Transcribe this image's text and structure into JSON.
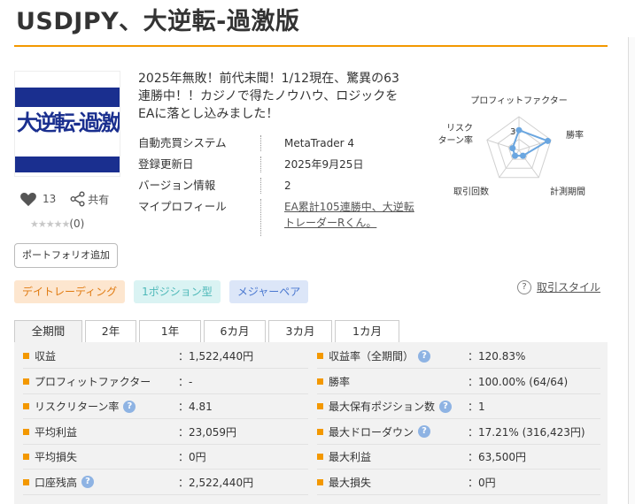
{
  "title": "USDJPY、大逆転-過激版",
  "logo_text": "大逆転-過激版",
  "likes": "13",
  "share_label": "共有",
  "stars": "★★★★★",
  "rating_count": "(0)",
  "portfolio_button": "ポートフォリオ追加",
  "description": "2025年無敗！前代未聞！1/12現在、驚異の63連勝中！！カジノで得たノウハウ、ロジックを EAに落とし込みました！",
  "info": [
    {
      "label": "自動売買システム",
      "value": "MetaTrader 4"
    },
    {
      "label": "登録更新日",
      "value": "2025年9月25日"
    },
    {
      "label": "バージョン情報",
      "value": "2"
    },
    {
      "label": "マイプロフィール",
      "value": "EA累計105連勝中、大逆転トレーダーRくん。"
    }
  ],
  "radar": {
    "labels": [
      "プロフィットファクター",
      "勝率",
      "計測期間",
      "取引回数",
      "リスク\nターン率"
    ],
    "scale_label": "3",
    "levels": [
      3,
      4.5,
      1,
      1,
      1
    ],
    "max": 5,
    "color": "#6aa6e0"
  },
  "tags": [
    "デイトレーディング",
    "1ポジション型",
    "メジャーペア"
  ],
  "trade_style": "取引スタイル",
  "tabs": [
    "全期間",
    "2年",
    "1年",
    "6カ月",
    "3カ月",
    "1カ月"
  ],
  "stats_left": [
    {
      "label": "収益",
      "value": "：1,522,440円",
      "help": false
    },
    {
      "label": "プロフィットファクター",
      "value": "：-",
      "help": false
    },
    {
      "label": "リスクリターン率",
      "value": "：4.81",
      "help": true
    },
    {
      "label": "平均利益",
      "value": "：23,059円",
      "help": false
    },
    {
      "label": "平均損失",
      "value": "：0円",
      "help": false
    },
    {
      "label": "口座残高",
      "value": "：2,522,440円",
      "help": true
    }
  ],
  "stats_right": [
    {
      "label": "収益率（全期間）",
      "value": "：120.83%",
      "help": true
    },
    {
      "label": "勝率",
      "value": "：100.00% (64/64)",
      "help": false
    },
    {
      "label": "最大保有ポジション数",
      "value": "：1",
      "help": true
    },
    {
      "label": "最大ドローダウン",
      "value": "：17.21% (316,423円)",
      "help": true
    },
    {
      "label": "最大利益",
      "value": "：63,500円",
      "help": false
    },
    {
      "label": "最大損失",
      "value": "：0円",
      "help": false
    }
  ],
  "colors": {
    "accent": "#f39800",
    "stats_bg": "#f2f2f2"
  }
}
